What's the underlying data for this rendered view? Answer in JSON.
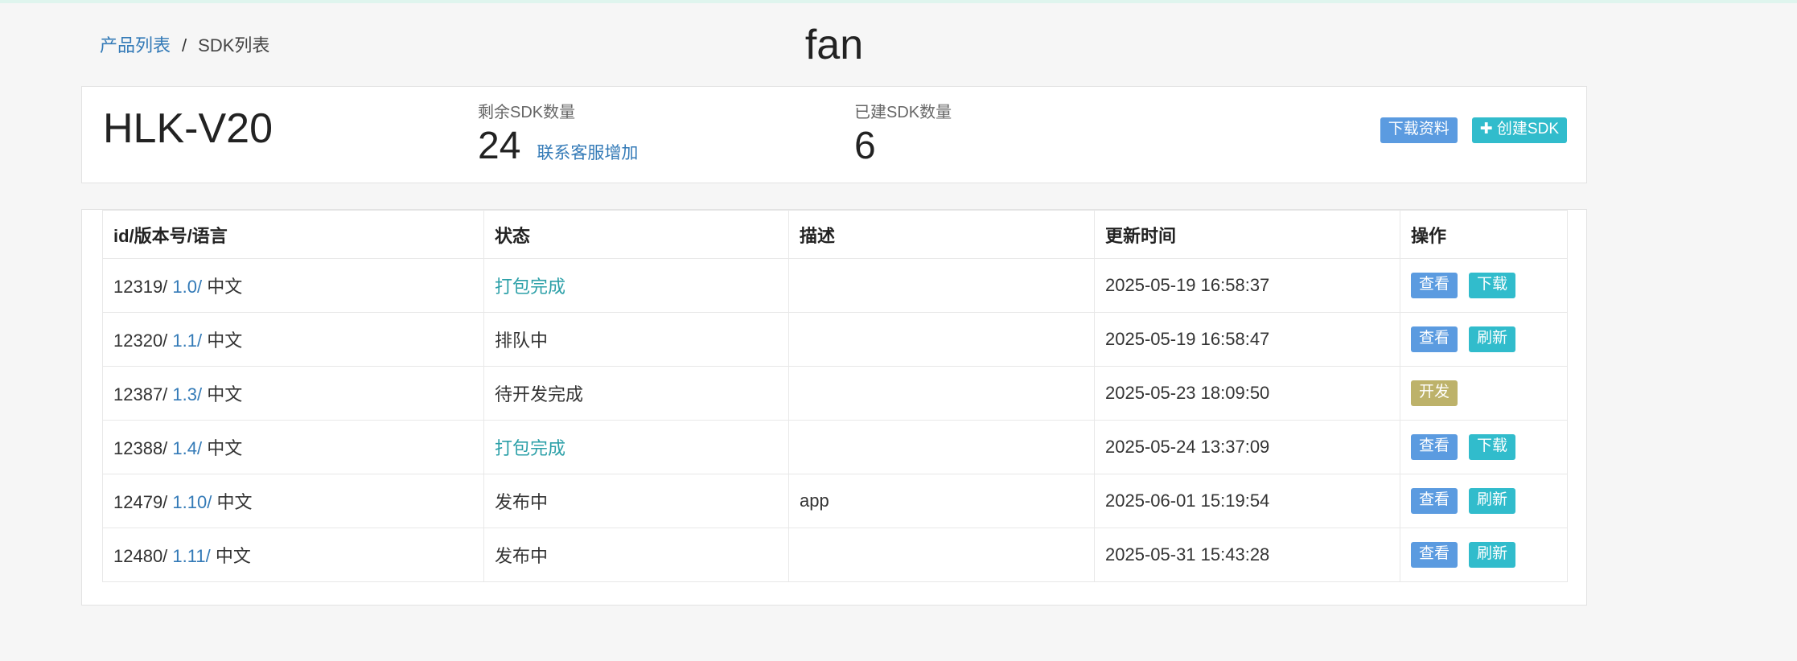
{
  "breadcrumb": {
    "root": "产品列表",
    "separator": "/",
    "current": "SDK列表"
  },
  "page_title": "fan",
  "summary": {
    "product_name": "HLK-V20",
    "remaining_label": "剩余SDK数量",
    "remaining_value": "24",
    "contact_link": "联系客服增加",
    "built_label": "已建SDK数量",
    "built_value": "6",
    "download_button": "下载资料",
    "create_button": "创建SDK",
    "create_icon": "plus-icon"
  },
  "table": {
    "headers": [
      "id/版本号/语言",
      "状态",
      "描述",
      "更新时间",
      "操作"
    ],
    "rows": [
      {
        "id": "12319/",
        "version": "1.0/",
        "lang": "中文",
        "status": "打包完成",
        "status_link": true,
        "desc": "",
        "time": "2025-05-19 16:58:37",
        "actions": [
          "查看",
          "下载"
        ]
      },
      {
        "id": "12320/",
        "version": "1.1/",
        "lang": "中文",
        "status": "排队中",
        "status_link": false,
        "desc": "",
        "time": "2025-05-19 16:58:47",
        "actions": [
          "查看",
          "刷新"
        ]
      },
      {
        "id": "12387/",
        "version": "1.3/",
        "lang": "中文",
        "status": "待开发完成",
        "status_link": false,
        "desc": "",
        "time": "2025-05-23 18:09:50",
        "actions": [
          "开发"
        ]
      },
      {
        "id": "12388/",
        "version": "1.4/",
        "lang": "中文",
        "status": "打包完成",
        "status_link": true,
        "desc": "",
        "time": "2025-05-24 13:37:09",
        "actions": [
          "查看",
          "下载"
        ]
      },
      {
        "id": "12479/",
        "version": "1.10/",
        "lang": "中文",
        "status": "发布中",
        "status_link": false,
        "desc": "app",
        "time": "2025-06-01 15:19:54",
        "actions": [
          "查看",
          "刷新"
        ]
      },
      {
        "id": "12480/",
        "version": "1.11/",
        "lang": "中文",
        "status": "发布中",
        "status_link": false,
        "desc": "",
        "time": "2025-05-31 15:43:28",
        "actions": [
          "查看",
          "刷新"
        ]
      }
    ]
  },
  "colors": {
    "link": "#337ab7",
    "status_done": "#2ca0a8",
    "btn_view": "#5b9be0",
    "btn_secondary": "#31bccc",
    "btn_develop": "#bdb26a"
  }
}
